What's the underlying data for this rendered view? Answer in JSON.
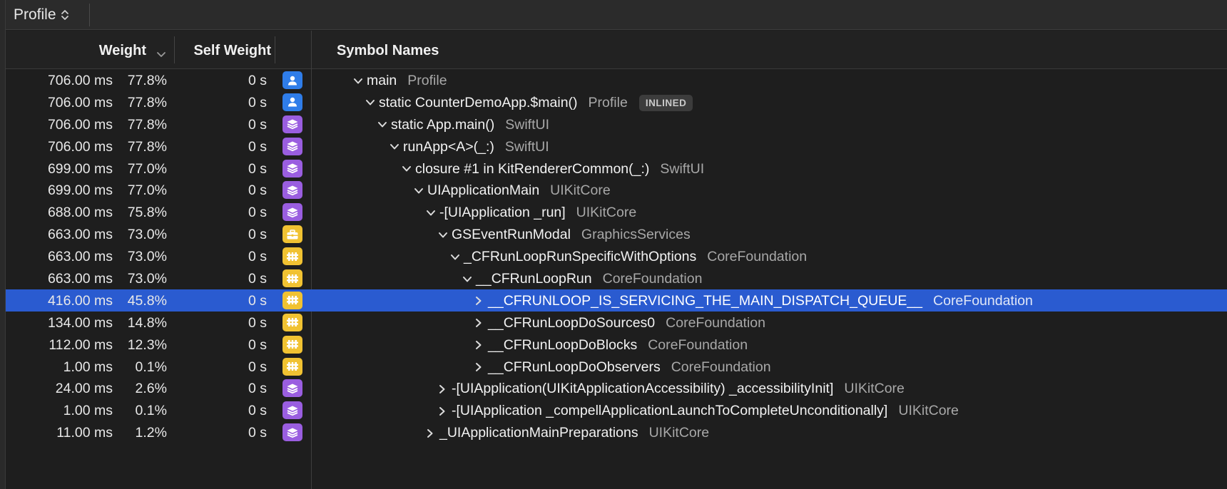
{
  "toolbar": {
    "profile_label": "Profile"
  },
  "header": {
    "weight_label": "Weight",
    "self_weight_label": "Self Weight",
    "symbol_names_label": "Symbol Names"
  },
  "colors": {
    "selection": "#2a5bd0",
    "user_badge": "#2f7de9",
    "framework_badge": "#9a5ee0",
    "system_badge": "#f1c232"
  },
  "rows": [
    {
      "ms": "706.00 ms",
      "pct": "77.8%",
      "self": "0 s",
      "icon": "user-icon",
      "depth": 0,
      "disclosure": "expanded",
      "name": "main",
      "lib": "Profile"
    },
    {
      "ms": "706.00 ms",
      "pct": "77.8%",
      "self": "0 s",
      "icon": "user-icon",
      "depth": 1,
      "disclosure": "expanded",
      "name": "static CounterDemoApp.$main()",
      "lib": "Profile",
      "tag": "INLINED"
    },
    {
      "ms": "706.00 ms",
      "pct": "77.8%",
      "self": "0 s",
      "icon": "layers-icon",
      "depth": 2,
      "disclosure": "expanded",
      "name": "static App.main()",
      "lib": "SwiftUI"
    },
    {
      "ms": "706.00 ms",
      "pct": "77.8%",
      "self": "0 s",
      "icon": "layers-icon",
      "depth": 3,
      "disclosure": "expanded",
      "name": "runApp<A>(_:)",
      "lib": "SwiftUI"
    },
    {
      "ms": "699.00 ms",
      "pct": "77.0%",
      "self": "0 s",
      "icon": "layers-icon",
      "depth": 4,
      "disclosure": "expanded",
      "name": "closure #1 in KitRendererCommon(_:)",
      "lib": "SwiftUI"
    },
    {
      "ms": "699.00 ms",
      "pct": "77.0%",
      "self": "0 s",
      "icon": "layers-icon",
      "depth": 5,
      "disclosure": "expanded",
      "name": "UIApplicationMain",
      "lib": "UIKitCore"
    },
    {
      "ms": "688.00 ms",
      "pct": "75.8%",
      "self": "0 s",
      "icon": "layers-icon",
      "depth": 6,
      "disclosure": "expanded",
      "name": "-[UIApplication _run]",
      "lib": "UIKitCore"
    },
    {
      "ms": "663.00 ms",
      "pct": "73.0%",
      "self": "0 s",
      "icon": "briefcase-icon",
      "depth": 7,
      "disclosure": "expanded",
      "name": "GSEventRunModal",
      "lib": "GraphicsServices"
    },
    {
      "ms": "663.00 ms",
      "pct": "73.0%",
      "self": "0 s",
      "icon": "puzzle-icon",
      "depth": 8,
      "disclosure": "expanded",
      "name": "_CFRunLoopRunSpecificWithOptions",
      "lib": "CoreFoundation"
    },
    {
      "ms": "663.00 ms",
      "pct": "73.0%",
      "self": "0 s",
      "icon": "puzzle-icon",
      "depth": 9,
      "disclosure": "expanded",
      "name": "__CFRunLoopRun",
      "lib": "CoreFoundation"
    },
    {
      "ms": "416.00 ms",
      "pct": "45.8%",
      "self": "0 s",
      "icon": "puzzle-icon",
      "depth": 10,
      "disclosure": "collapsed",
      "name": "__CFRUNLOOP_IS_SERVICING_THE_MAIN_DISPATCH_QUEUE__",
      "lib": "CoreFoundation",
      "selected": true
    },
    {
      "ms": "134.00 ms",
      "pct": "14.8%",
      "self": "0 s",
      "icon": "puzzle-icon",
      "depth": 10,
      "disclosure": "collapsed",
      "name": "__CFRunLoopDoSources0",
      "lib": "CoreFoundation"
    },
    {
      "ms": "112.00 ms",
      "pct": "12.3%",
      "self": "0 s",
      "icon": "puzzle-icon",
      "depth": 10,
      "disclosure": "collapsed",
      "name": "__CFRunLoopDoBlocks",
      "lib": "CoreFoundation"
    },
    {
      "ms": "1.00 ms",
      "pct": "0.1%",
      "self": "0 s",
      "icon": "puzzle-icon",
      "depth": 10,
      "disclosure": "collapsed",
      "name": "__CFRunLoopDoObservers",
      "lib": "CoreFoundation"
    },
    {
      "ms": "24.00 ms",
      "pct": "2.6%",
      "self": "0 s",
      "icon": "layers-icon",
      "depth": 7,
      "disclosure": "collapsed",
      "name": "-[UIApplication(UIKitApplicationAccessibility) _accessibilityInit]",
      "lib": "UIKitCore"
    },
    {
      "ms": "1.00 ms",
      "pct": "0.1%",
      "self": "0 s",
      "icon": "layers-icon",
      "depth": 7,
      "disclosure": "collapsed",
      "name": "-[UIApplication _compellApplicationLaunchToCompleteUnconditionally]",
      "lib": "UIKitCore"
    },
    {
      "ms": "11.00 ms",
      "pct": "1.2%",
      "self": "0 s",
      "icon": "layers-icon",
      "depth": 6,
      "disclosure": "collapsed",
      "name": "_UIApplicationMainPreparations",
      "lib": "UIKitCore"
    }
  ]
}
